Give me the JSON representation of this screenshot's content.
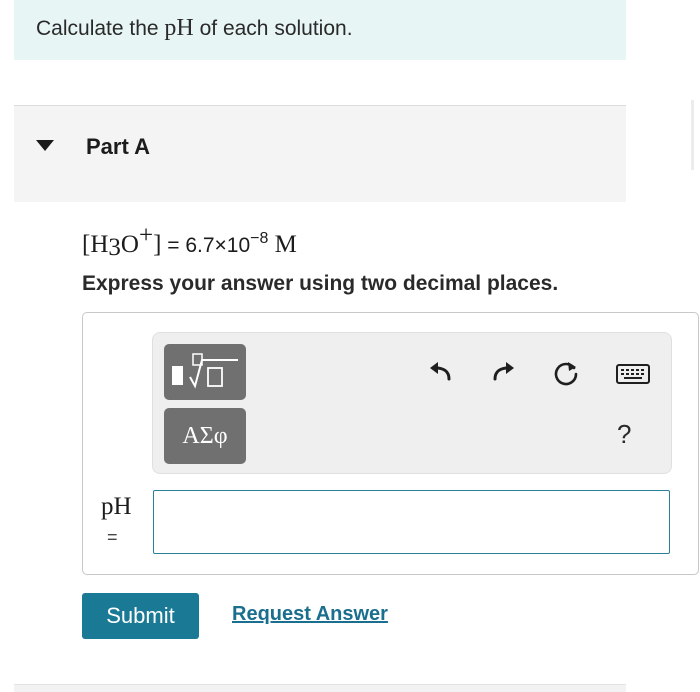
{
  "intro": {
    "text_before": "Calculate the ",
    "text_ph": "pH",
    "text_after": " of each solution."
  },
  "part": {
    "title": "Part A"
  },
  "equation": {
    "lbracket": "[",
    "h": "H",
    "sub3": "3",
    "o": "O",
    "plus": "+",
    "rbracket": "]",
    "eq": " = 6.7×10",
    "exp": "−8",
    "unit": " M"
  },
  "instruction": "Express your answer using two decimal places.",
  "toolbar": {
    "symbols_label": "ΑΣφ",
    "help_label": "?"
  },
  "answer": {
    "label": "pH",
    "equals": "=",
    "value": ""
  },
  "actions": {
    "submit_label": "Submit",
    "request_label": "Request Answer"
  },
  "colors": {
    "intro_bg": "#e8f5f5",
    "accent": "#1a7a96",
    "toolbar_button": "#707070"
  }
}
